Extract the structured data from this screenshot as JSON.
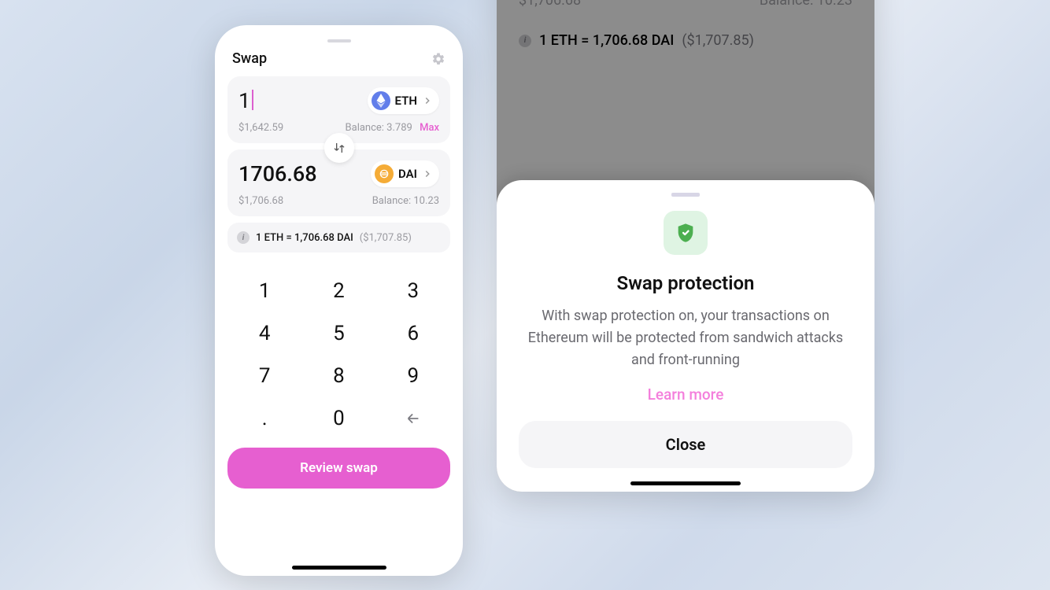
{
  "swap": {
    "title": "Swap",
    "from": {
      "amount": "1",
      "usd": "$1,642.59",
      "balance_label": "Balance: 3.789",
      "max_label": "Max",
      "symbol": "ETH"
    },
    "to": {
      "amount": "1706.68",
      "usd": "$1,706.68",
      "balance_label": "Balance: 10.23",
      "symbol": "DAI"
    },
    "rate": {
      "text": "1 ETH = 1,706.68 DAI",
      "secondary": "($1,707.85)"
    },
    "keypad": [
      "1",
      "2",
      "3",
      "4",
      "5",
      "6",
      "7",
      "8",
      "9",
      ".",
      "0",
      "back"
    ],
    "review_label": "Review swap"
  },
  "behind": {
    "usd": "$1,706.68",
    "balance": "Balance: 10.23",
    "rate_text": "1 ETH = 1,706.68 DAI",
    "rate_secondary": "($1,707.85)"
  },
  "sheet": {
    "title": "Swap protection",
    "body": "With swap protection on, your transactions on Ethereum will be protected from sandwich attacks and front-running",
    "link": "Learn more",
    "close": "Close"
  }
}
